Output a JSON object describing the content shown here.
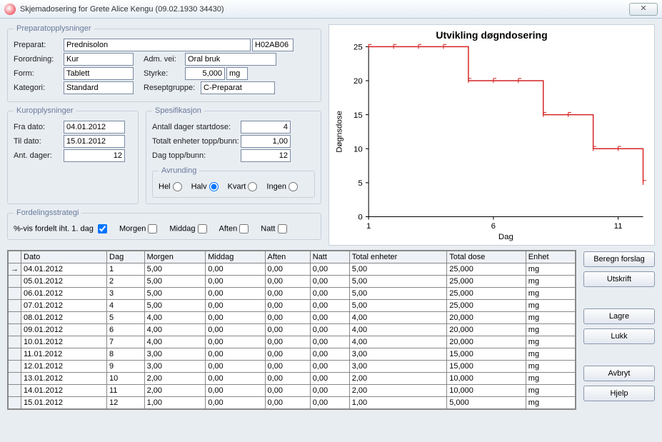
{
  "window": {
    "title": "Skjemadosering for Grete Alice Kengu (09.02.1930 34430)"
  },
  "prep": {
    "legend": "Preparatopplysninger",
    "preparat_lbl": "Preparat:",
    "preparat": "Prednisolon",
    "atc": "H02AB06",
    "forordning_lbl": "Forordning:",
    "forordning": "Kur",
    "admvei_lbl": "Adm. vei:",
    "admvei": "Oral bruk",
    "form_lbl": "Form:",
    "form": "Tablett",
    "styrke_lbl": "Styrke:",
    "styrke": "5,000",
    "styrke_unit": "mg",
    "kategori_lbl": "Kategori:",
    "kategori": "Standard",
    "reseptgruppe_lbl": "Reseptgruppe:",
    "reseptgruppe": "C-Preparat"
  },
  "kur": {
    "legend": "Kuropplysninger",
    "fra_lbl": "Fra dato:",
    "fra": "04.01.2012",
    "til_lbl": "Til dato:",
    "til": "15.01.2012",
    "ant_lbl": "Ant. dager:",
    "ant": "12"
  },
  "spes": {
    "legend": "Spesifikasjon",
    "antall_lbl": "Antall dager startdose:",
    "antall": "4",
    "totalt_lbl": "Totalt enheter topp/bunn:",
    "totalt": "1,00",
    "dag_lbl": "Dag topp/bunn:",
    "dag": "12",
    "avrunding_legend": "Avrunding",
    "hel": "Hel",
    "halv": "Halv",
    "kvart": "Kvart",
    "ingen": "Ingen"
  },
  "fordel": {
    "legend": "Fordelingsstrategi",
    "pct_lbl": "%-vis fordelt iht. 1. dag",
    "morgen": "Morgen",
    "middag": "Middag",
    "aften": "Aften",
    "natt": "Natt"
  },
  "grid": {
    "cols": [
      "Dato",
      "Dag",
      "Morgen",
      "Middag",
      "Aften",
      "Natt",
      "Total enheter",
      "Total dose",
      "Enhet"
    ],
    "rows": [
      [
        "04.01.2012",
        "1",
        "5,00",
        "0,00",
        "0,00",
        "0,00",
        "5,00",
        "25,000",
        "mg"
      ],
      [
        "05.01.2012",
        "2",
        "5,00",
        "0,00",
        "0,00",
        "0,00",
        "5,00",
        "25,000",
        "mg"
      ],
      [
        "06.01.2012",
        "3",
        "5,00",
        "0,00",
        "0,00",
        "0,00",
        "5,00",
        "25,000",
        "mg"
      ],
      [
        "07.01.2012",
        "4",
        "5,00",
        "0,00",
        "0,00",
        "0,00",
        "5,00",
        "25,000",
        "mg"
      ],
      [
        "08.01.2012",
        "5",
        "4,00",
        "0,00",
        "0,00",
        "0,00",
        "4,00",
        "20,000",
        "mg"
      ],
      [
        "09.01.2012",
        "6",
        "4,00",
        "0,00",
        "0,00",
        "0,00",
        "4,00",
        "20,000",
        "mg"
      ],
      [
        "10.01.2012",
        "7",
        "4,00",
        "0,00",
        "0,00",
        "0,00",
        "4,00",
        "20,000",
        "mg"
      ],
      [
        "11.01.2012",
        "8",
        "3,00",
        "0,00",
        "0,00",
        "0,00",
        "3,00",
        "15,000",
        "mg"
      ],
      [
        "12.01.2012",
        "9",
        "3,00",
        "0,00",
        "0,00",
        "0,00",
        "3,00",
        "15,000",
        "mg"
      ],
      [
        "13.01.2012",
        "10",
        "2,00",
        "0,00",
        "0,00",
        "0,00",
        "2,00",
        "10,000",
        "mg"
      ],
      [
        "14.01.2012",
        "11",
        "2,00",
        "0,00",
        "0,00",
        "0,00",
        "2,00",
        "10,000",
        "mg"
      ],
      [
        "15.01.2012",
        "12",
        "1,00",
        "0,00",
        "0,00",
        "0,00",
        "1,00",
        "5,000",
        "mg"
      ]
    ]
  },
  "buttons": {
    "beregn": "Beregn forslag",
    "utskrift": "Utskrift",
    "lagre": "Lagre",
    "lukk": "Lukk",
    "avbryt": "Avbryt",
    "hjelp": "Hjelp"
  },
  "chart_data": {
    "type": "line",
    "title": "Utvikling døgndosering",
    "xlabel": "Dag",
    "ylabel": "Døgnsdose",
    "x": [
      1,
      2,
      3,
      4,
      5,
      6,
      7,
      8,
      9,
      10,
      11,
      12
    ],
    "values": [
      25,
      25,
      25,
      25,
      20,
      20,
      20,
      15,
      15,
      10,
      10,
      5
    ],
    "ylim": [
      0,
      25
    ],
    "xticks": [
      1,
      6,
      11
    ],
    "yticks": [
      0,
      5,
      10,
      15,
      20,
      25
    ],
    "color": "#d62222"
  }
}
